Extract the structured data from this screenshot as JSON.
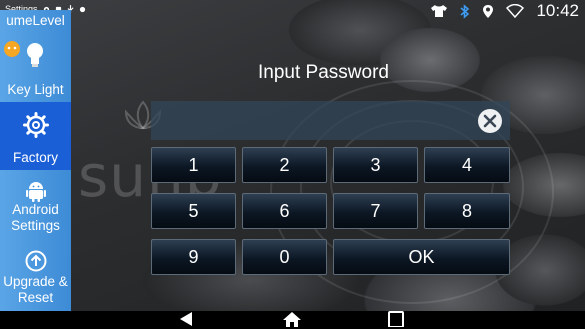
{
  "statusbar": {
    "app_name": "Settings",
    "time": "10:42",
    "left_icons": [
      "settings-icon",
      "notification-icon",
      "usb-icon",
      "app-icon"
    ],
    "right_icons": [
      "tshirt-icon",
      "bluetooth-icon",
      "location-icon",
      "wifi-icon"
    ]
  },
  "sidebar": {
    "items": [
      {
        "label": "umeLevel",
        "icon": "volume-icon"
      },
      {
        "label": "Key Light",
        "icon": "lightbulb-icon"
      },
      {
        "label": "Factory",
        "icon": "gear-icon",
        "active": true
      },
      {
        "label": "Android Settings",
        "icon": "android-icon"
      },
      {
        "label": "Upgrade & Reset",
        "icon": "upgrade-icon"
      }
    ]
  },
  "dialog": {
    "title": "Input Password",
    "password_value": "",
    "clear_icon": "close-icon"
  },
  "keypad": {
    "row1": [
      "1",
      "2",
      "3",
      "4"
    ],
    "row2": [
      "5",
      "6",
      "7",
      "8"
    ],
    "row3": [
      "9",
      "0"
    ],
    "ok": "OK"
  },
  "wallpaper": {
    "watermark": "sunb"
  },
  "navbar": {
    "buttons": [
      "back-icon",
      "home-icon",
      "recents-icon"
    ]
  },
  "colors": {
    "sidebar_bg": "#4a98dd",
    "sidebar_active": "#1a5fd6",
    "key_bg": "#0c1724",
    "navbar_bg": "#000000"
  }
}
